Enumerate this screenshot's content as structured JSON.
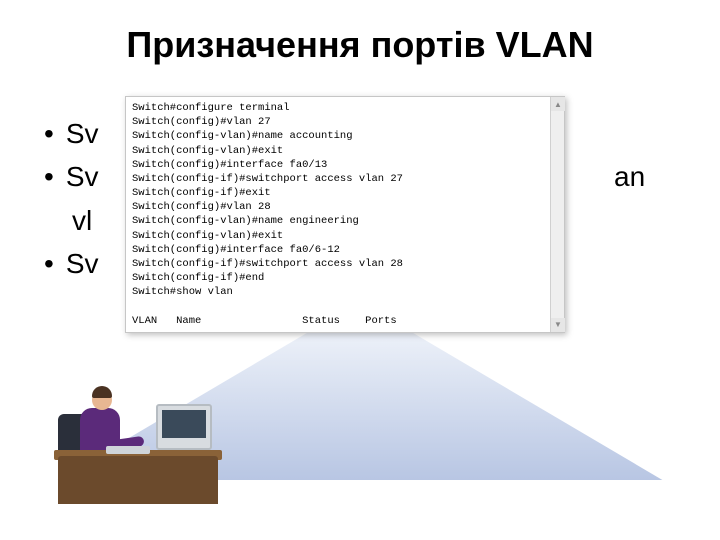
{
  "title": "Призначення портів VLAN",
  "bullets": {
    "b1": "Sv",
    "b2a": "Sv",
    "b2b": "an",
    "b2c": "vl",
    "b3": "Sv"
  },
  "terminal_lines": [
    "Switch#configure terminal",
    "Switch(config)#vlan 27",
    "Switch(config-vlan)#name accounting",
    "Switch(config-vlan)#exit",
    "Switch(config)#interface fa0/13",
    "Switch(config-if)#switchport access vlan 27",
    "Switch(config-if)#exit",
    "Switch(config)#vlan 28",
    "Switch(config-vlan)#name engineering",
    "Switch(config-vlan)#exit",
    "Switch(config)#interface fa0/6-12",
    "Switch(config-if)#switchport access vlan 28",
    "Switch(config-if)#end",
    "Switch#show vlan",
    "",
    "VLAN   Name                Status    Ports"
  ],
  "scroll": {
    "up": "▲",
    "down": "▼"
  }
}
